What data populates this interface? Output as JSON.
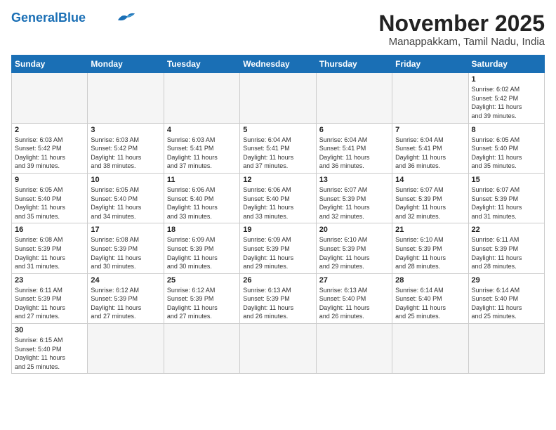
{
  "header": {
    "logo_general": "General",
    "logo_blue": "Blue",
    "month_title": "November 2025",
    "subtitle": "Manappakkam, Tamil Nadu, India"
  },
  "weekdays": [
    "Sunday",
    "Monday",
    "Tuesday",
    "Wednesday",
    "Thursday",
    "Friday",
    "Saturday"
  ],
  "days": [
    {
      "num": "",
      "info": ""
    },
    {
      "num": "",
      "info": ""
    },
    {
      "num": "",
      "info": ""
    },
    {
      "num": "",
      "info": ""
    },
    {
      "num": "",
      "info": ""
    },
    {
      "num": "",
      "info": ""
    },
    {
      "num": "1",
      "info": "Sunrise: 6:02 AM\nSunset: 5:42 PM\nDaylight: 11 hours\nand 39 minutes."
    },
    {
      "num": "2",
      "info": "Sunrise: 6:03 AM\nSunset: 5:42 PM\nDaylight: 11 hours\nand 39 minutes."
    },
    {
      "num": "3",
      "info": "Sunrise: 6:03 AM\nSunset: 5:42 PM\nDaylight: 11 hours\nand 38 minutes."
    },
    {
      "num": "4",
      "info": "Sunrise: 6:03 AM\nSunset: 5:41 PM\nDaylight: 11 hours\nand 37 minutes."
    },
    {
      "num": "5",
      "info": "Sunrise: 6:04 AM\nSunset: 5:41 PM\nDaylight: 11 hours\nand 37 minutes."
    },
    {
      "num": "6",
      "info": "Sunrise: 6:04 AM\nSunset: 5:41 PM\nDaylight: 11 hours\nand 36 minutes."
    },
    {
      "num": "7",
      "info": "Sunrise: 6:04 AM\nSunset: 5:41 PM\nDaylight: 11 hours\nand 36 minutes."
    },
    {
      "num": "8",
      "info": "Sunrise: 6:05 AM\nSunset: 5:40 PM\nDaylight: 11 hours\nand 35 minutes."
    },
    {
      "num": "9",
      "info": "Sunrise: 6:05 AM\nSunset: 5:40 PM\nDaylight: 11 hours\nand 35 minutes."
    },
    {
      "num": "10",
      "info": "Sunrise: 6:05 AM\nSunset: 5:40 PM\nDaylight: 11 hours\nand 34 minutes."
    },
    {
      "num": "11",
      "info": "Sunrise: 6:06 AM\nSunset: 5:40 PM\nDaylight: 11 hours\nand 33 minutes."
    },
    {
      "num": "12",
      "info": "Sunrise: 6:06 AM\nSunset: 5:40 PM\nDaylight: 11 hours\nand 33 minutes."
    },
    {
      "num": "13",
      "info": "Sunrise: 6:07 AM\nSunset: 5:39 PM\nDaylight: 11 hours\nand 32 minutes."
    },
    {
      "num": "14",
      "info": "Sunrise: 6:07 AM\nSunset: 5:39 PM\nDaylight: 11 hours\nand 32 minutes."
    },
    {
      "num": "15",
      "info": "Sunrise: 6:07 AM\nSunset: 5:39 PM\nDaylight: 11 hours\nand 31 minutes."
    },
    {
      "num": "16",
      "info": "Sunrise: 6:08 AM\nSunset: 5:39 PM\nDaylight: 11 hours\nand 31 minutes."
    },
    {
      "num": "17",
      "info": "Sunrise: 6:08 AM\nSunset: 5:39 PM\nDaylight: 11 hours\nand 30 minutes."
    },
    {
      "num": "18",
      "info": "Sunrise: 6:09 AM\nSunset: 5:39 PM\nDaylight: 11 hours\nand 30 minutes."
    },
    {
      "num": "19",
      "info": "Sunrise: 6:09 AM\nSunset: 5:39 PM\nDaylight: 11 hours\nand 29 minutes."
    },
    {
      "num": "20",
      "info": "Sunrise: 6:10 AM\nSunset: 5:39 PM\nDaylight: 11 hours\nand 29 minutes."
    },
    {
      "num": "21",
      "info": "Sunrise: 6:10 AM\nSunset: 5:39 PM\nDaylight: 11 hours\nand 28 minutes."
    },
    {
      "num": "22",
      "info": "Sunrise: 6:11 AM\nSunset: 5:39 PM\nDaylight: 11 hours\nand 28 minutes."
    },
    {
      "num": "23",
      "info": "Sunrise: 6:11 AM\nSunset: 5:39 PM\nDaylight: 11 hours\nand 27 minutes."
    },
    {
      "num": "24",
      "info": "Sunrise: 6:12 AM\nSunset: 5:39 PM\nDaylight: 11 hours\nand 27 minutes."
    },
    {
      "num": "25",
      "info": "Sunrise: 6:12 AM\nSunset: 5:39 PM\nDaylight: 11 hours\nand 27 minutes."
    },
    {
      "num": "26",
      "info": "Sunrise: 6:13 AM\nSunset: 5:39 PM\nDaylight: 11 hours\nand 26 minutes."
    },
    {
      "num": "27",
      "info": "Sunrise: 6:13 AM\nSunset: 5:40 PM\nDaylight: 11 hours\nand 26 minutes."
    },
    {
      "num": "28",
      "info": "Sunrise: 6:14 AM\nSunset: 5:40 PM\nDaylight: 11 hours\nand 25 minutes."
    },
    {
      "num": "29",
      "info": "Sunrise: 6:14 AM\nSunset: 5:40 PM\nDaylight: 11 hours\nand 25 minutes."
    },
    {
      "num": "30",
      "info": "Sunrise: 6:15 AM\nSunset: 5:40 PM\nDaylight: 11 hours\nand 25 minutes."
    },
    {
      "num": "",
      "info": ""
    },
    {
      "num": "",
      "info": ""
    },
    {
      "num": "",
      "info": ""
    },
    {
      "num": "",
      "info": ""
    },
    {
      "num": "",
      "info": ""
    },
    {
      "num": "",
      "info": ""
    }
  ]
}
